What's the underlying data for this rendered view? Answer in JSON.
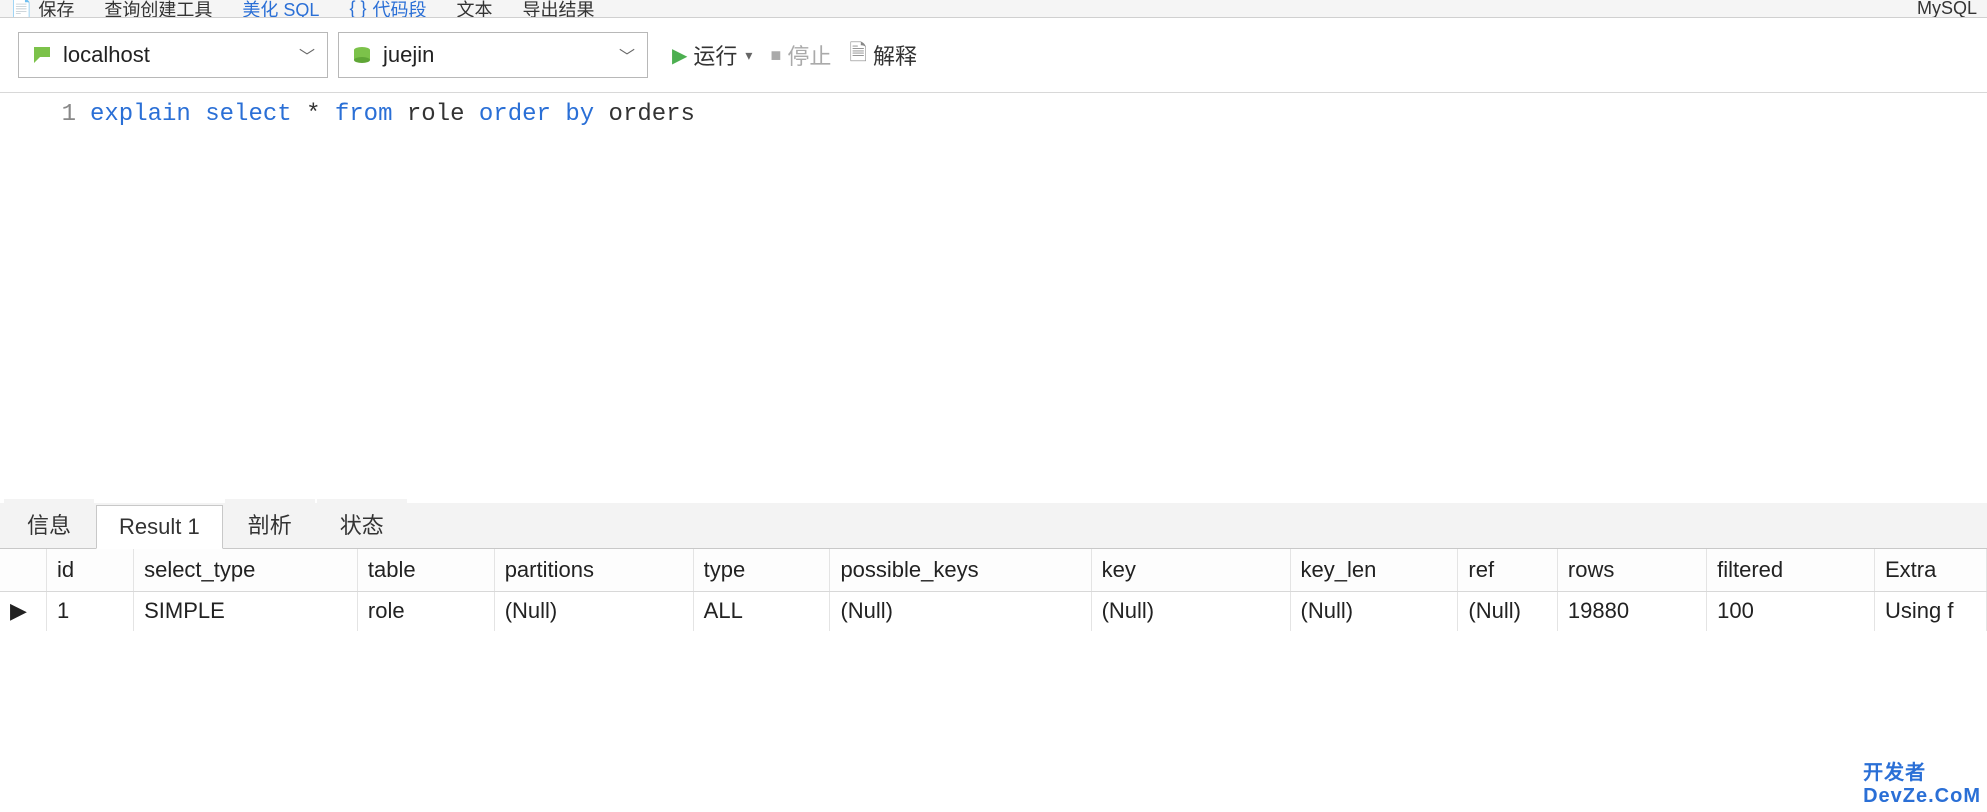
{
  "toolbar": {
    "save": "保存",
    "query_builder": "查询创建工具",
    "beautify_sql": "美化 SQL",
    "code_snippet": "代码段",
    "text": "文本",
    "export_result": "导出结果",
    "right_faint": "MySQL"
  },
  "conn": {
    "host": "localhost",
    "database": "juejin"
  },
  "actions": {
    "run": "运行",
    "stop": "停止",
    "explain": "解释"
  },
  "editor": {
    "line_no": "1",
    "tokens": {
      "explain": "explain",
      "select": "select",
      "star": "*",
      "from": "from",
      "table": "role",
      "order": "order",
      "by": "by",
      "col": "orders"
    }
  },
  "tabs": {
    "info": "信息",
    "result": "Result 1",
    "profile": "剖析",
    "status": "状态"
  },
  "result_table": {
    "headers": {
      "id": "id",
      "select_type": "select_type",
      "table": "table",
      "partitions": "partitions",
      "type": "type",
      "possible_keys": "possible_keys",
      "key": "key",
      "key_len": "key_len",
      "ref": "ref",
      "rows": "rows",
      "filtered": "filtered",
      "extra": "Extra"
    },
    "row": {
      "handle": "▶",
      "id": "1",
      "select_type": "SIMPLE",
      "table": "role",
      "partitions": "(Null)",
      "type": "ALL",
      "possible_keys": "(Null)",
      "key": "(Null)",
      "key_len": "(Null)",
      "ref": "(Null)",
      "rows": "19880",
      "filtered": "100",
      "extra": "Using f"
    }
  },
  "watermark": {
    "line1": "开发者",
    "line2": "DevZe.CoM"
  }
}
